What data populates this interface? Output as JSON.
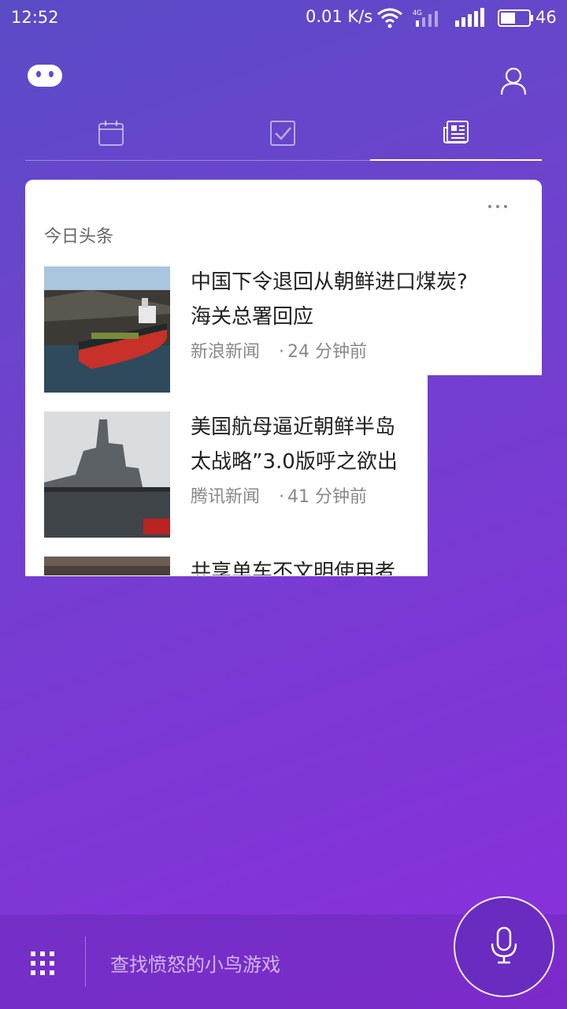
{
  "status_bar": {
    "time": "12:52",
    "net_speed": "0.01 K/s",
    "battery": "46",
    "icons": [
      "wifi-icon",
      "signal-4g-icon",
      "signal-icon",
      "battery-icon"
    ]
  },
  "header": {
    "icons": [
      "assistant-logo-icon",
      "user-icon"
    ]
  },
  "tabs": [
    {
      "icon": "calendar-icon",
      "active": false
    },
    {
      "icon": "checkbox-icon",
      "active": false
    },
    {
      "icon": "news-icon",
      "active": true
    }
  ],
  "card": {
    "title": "今日头条",
    "items": [
      {
        "headline": "中国下令退回从朝鲜进口煤炭?\n海关总署回应",
        "source": "新浪新闻",
        "time": "24 分钟前"
      },
      {
        "headline": "美国航母逼近朝鲜半岛\n太战略”3.0版呼之欲出",
        "source": "腾讯新闻",
        "time": "41 分钟前"
      },
      {
        "headline": "共享单车不文明使用者",
        "source": "",
        "time": ""
      }
    ]
  },
  "bottom": {
    "search_placeholder": "查找愤怒的小鸟游戏",
    "icons": [
      "apps-grid-icon",
      "microphone-icon"
    ]
  }
}
